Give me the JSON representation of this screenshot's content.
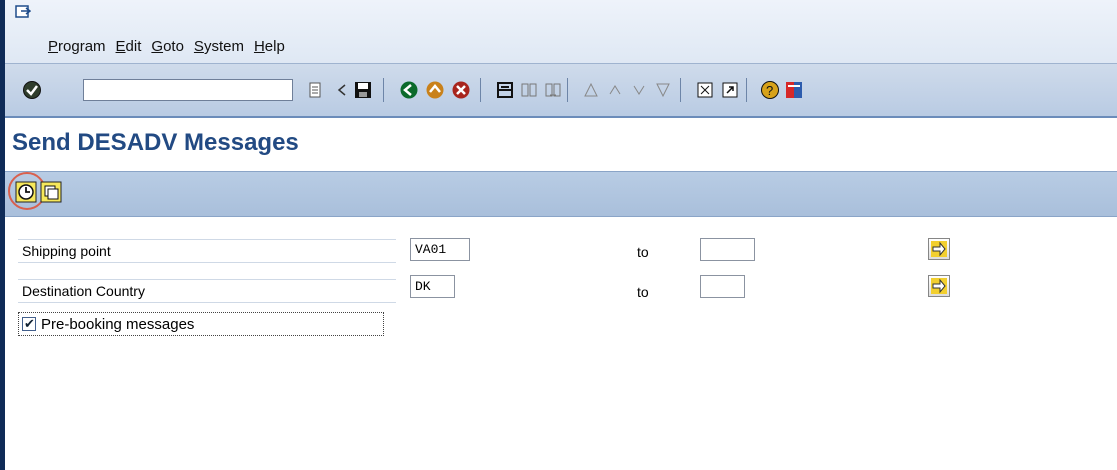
{
  "menu": {
    "items": [
      "Program",
      "Edit",
      "Goto",
      "System",
      "Help"
    ],
    "underline": [
      "P",
      "E",
      "G",
      "S",
      "H"
    ]
  },
  "toolbar": {
    "command_value": "",
    "icons": [
      "enter-icon",
      "command-history-icon",
      "back-icon",
      "save-icon",
      "back-nav-icon",
      "exit-icon",
      "cancel-icon",
      "print-icon",
      "find-icon",
      "find-next-icon",
      "first-page-icon",
      "previous-page-icon",
      "next-page-icon",
      "last-page-icon",
      "create-session-icon",
      "shortcut-icon",
      "help-icon",
      "layout-icon"
    ]
  },
  "page": {
    "title": "Send DESADV Messages"
  },
  "app_toolbar": {
    "buttons": [
      "execute-icon",
      "selection-variant-icon"
    ]
  },
  "form": {
    "shipping_point": {
      "label": "Shipping point",
      "value": "VA01",
      "to_label": "to",
      "to_value": ""
    },
    "destination_country": {
      "label": "Destination Country",
      "value": "DK",
      "to_label": "to",
      "to_value": ""
    },
    "prebooking": {
      "label": "Pre-booking messages",
      "checked": true
    }
  },
  "colors": {
    "title": "#224a83",
    "highlight": "#d9604d"
  }
}
